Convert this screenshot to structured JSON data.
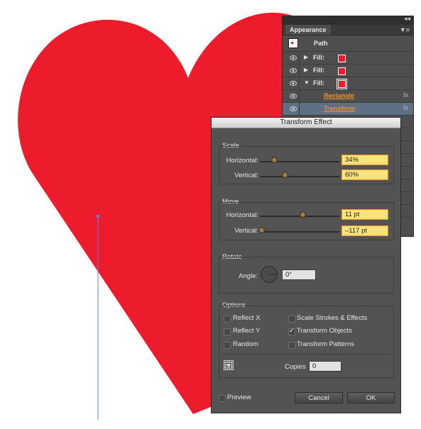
{
  "canvas": {
    "fill_color": "#ec1c2d"
  },
  "appearance": {
    "tab_label": "Appearance",
    "object_label": "Path",
    "rows": [
      {
        "label": "Fill:"
      },
      {
        "label": "Fill:"
      },
      {
        "label": "Fill:"
      }
    ],
    "effects": [
      {
        "label": "Rectangle",
        "fx": "fx"
      },
      {
        "label": "Transform",
        "fx": "fx"
      }
    ]
  },
  "dialog": {
    "title": "Transform Effect",
    "scale": {
      "label": "Scale",
      "horizontal_label": "Horizontal:",
      "horizontal_value": "34%",
      "vertical_label": "Vertical:",
      "vertical_value": "60%"
    },
    "move": {
      "label": "Move",
      "horizontal_label": "Horizontal:",
      "horizontal_value": "11 pt",
      "vertical_label": "Vertical:",
      "vertical_value": "–117 pt"
    },
    "rotate": {
      "label": "Rotate",
      "angle_label": "Angle:",
      "angle_value": "0°"
    },
    "options": {
      "label": "Options",
      "reflect_x": {
        "label": "Reflect X",
        "checked": false
      },
      "reflect_y": {
        "label": "Reflect Y",
        "checked": false
      },
      "random": {
        "label": "Random",
        "checked": false
      },
      "scale_strokes": {
        "label": "Scale Strokes & Effects",
        "checked": false
      },
      "transform_objects": {
        "label": "Transform Objects",
        "checked": true
      },
      "transform_patterns": {
        "label": "Transform Patterns",
        "checked": false
      },
      "copies_label": "Copies",
      "copies_value": "0"
    },
    "preview": {
      "label": "Preview",
      "checked": false
    },
    "cancel_label": "Cancel",
    "ok_label": "OK"
  }
}
